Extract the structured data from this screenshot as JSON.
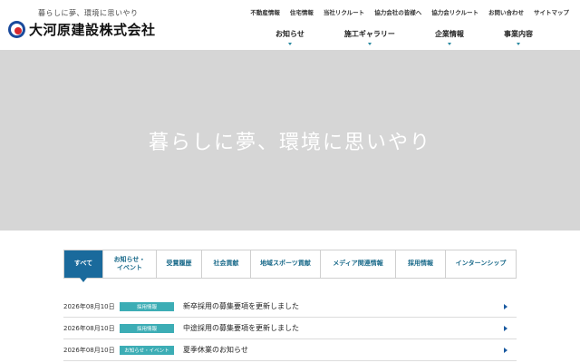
{
  "header": {
    "tagline": "暮らしに夢、環境に思いやり",
    "logo_text": "大河原建設株式会社",
    "util_nav": [
      "不動産情報",
      "住宅情報",
      "当社リクルート",
      "協力会社の皆様へ",
      "協力会リクルート",
      "お問い合わせ",
      "サイトマップ"
    ],
    "main_nav": [
      "お知らせ",
      "施工ギャラリー",
      "企業情報",
      "事業内容"
    ]
  },
  "hero": {
    "text": "暮らしに夢、環境に思いやり"
  },
  "tabs": [
    {
      "label": "すべて",
      "active": true
    },
    {
      "label": "お知らせ・\nイベント"
    },
    {
      "label": "受賞履歴"
    },
    {
      "label": "社会貢献"
    },
    {
      "label": "地域スポーツ貢献"
    },
    {
      "label": "メディア関連情報"
    },
    {
      "label": "採用情報"
    },
    {
      "label": "インターンシップ"
    }
  ],
  "news": [
    {
      "date": "2026年08月10日",
      "category": "採用情報",
      "title": "新卒採用の募集要項を更新しました"
    },
    {
      "date": "2026年08月10日",
      "category": "採用情報",
      "title": "中途採用の募集要項を更新しました"
    },
    {
      "date": "2026年08月10日",
      "category": "お知らせ・イベント",
      "title": "夏季休業のお知らせ"
    }
  ],
  "colors": {
    "brand_blue": "#1a6a9c",
    "badge_teal": "#3cadb5",
    "logo_red": "#d7282f"
  }
}
